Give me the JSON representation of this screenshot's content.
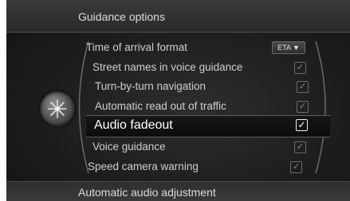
{
  "header": {
    "title": "Guidance options"
  },
  "footer": {
    "title": "Automatic audio adjustment"
  },
  "menu": {
    "time_format": {
      "label": "Time of arrival format",
      "value": "ETA",
      "arrow": "▼"
    },
    "items": [
      {
        "label": "Street names in voice guidance",
        "checked": true
      },
      {
        "label": "Turn-by-turn navigation",
        "checked": true
      },
      {
        "label": "Automatic read out of traffic",
        "checked": true
      },
      {
        "label": "Audio fadeout",
        "checked": true,
        "selected": true
      },
      {
        "label": "Voice guidance",
        "checked": true
      },
      {
        "label": "Speed camera warning",
        "checked": true
      }
    ]
  },
  "icons": {
    "dial": "navigation-dial-icon",
    "check": "checkmark-icon"
  },
  "colors": {
    "background": "#1d1d1d",
    "text": "#cfcfcf",
    "selected_text": "#ffffff"
  }
}
